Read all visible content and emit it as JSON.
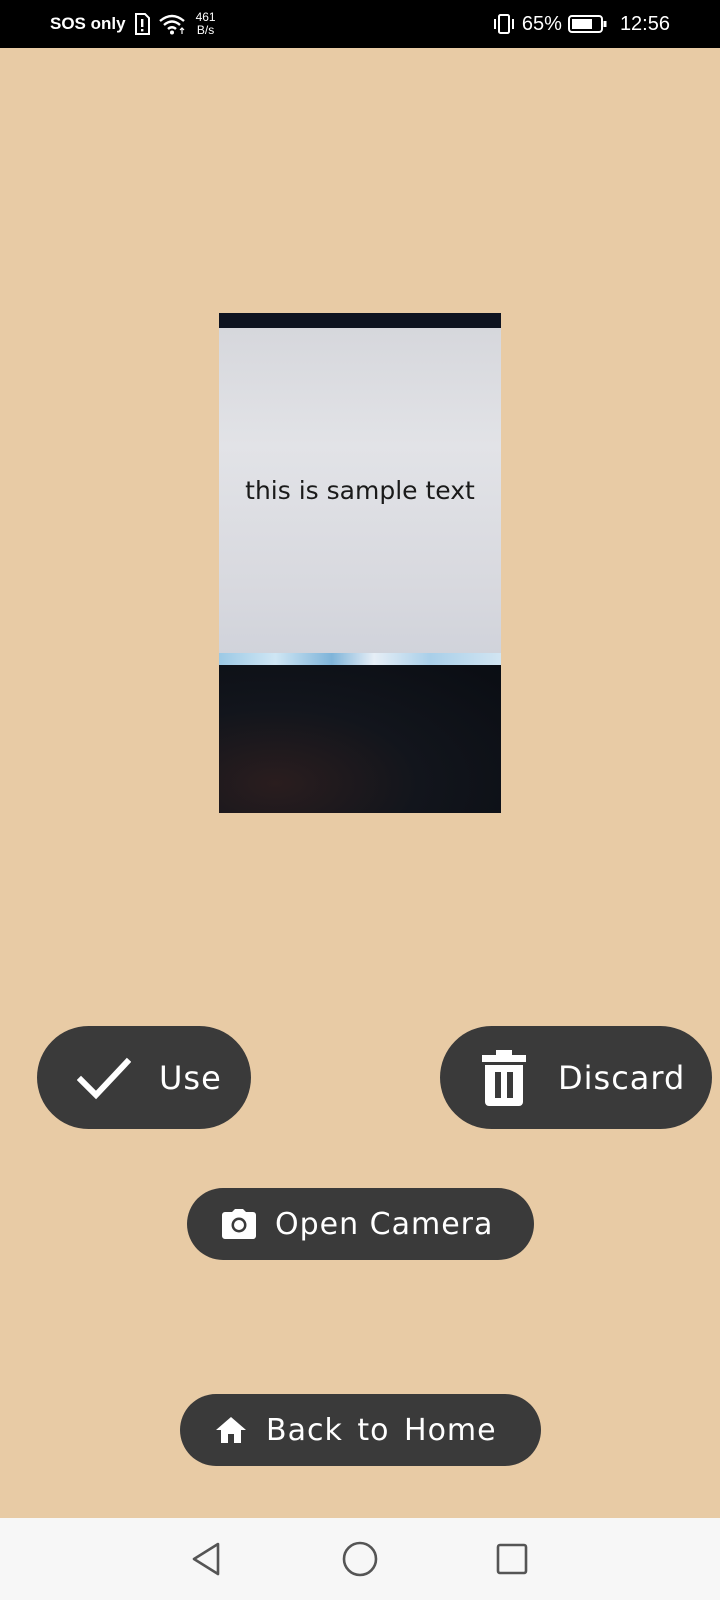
{
  "status_bar": {
    "carrier": "SOS only",
    "net_speed_value": "461",
    "net_speed_unit": "B/s",
    "battery_percent": "65%",
    "time": "12:56",
    "icons": [
      "sim-alert-icon",
      "wifi-icon",
      "vibrate-icon",
      "battery-icon"
    ]
  },
  "preview": {
    "photo_text": "this is sample text"
  },
  "actions": {
    "use_label": "Use",
    "discard_label": "Discard",
    "open_camera_label": "Open Camera",
    "back_home_label": "Back to Home"
  },
  "colors": {
    "background": "#e8cba5",
    "button": "#3a3a3a",
    "button_text": "#ffffff"
  },
  "nav_bar": {
    "icons": [
      "back-icon",
      "home-icon",
      "recents-icon"
    ]
  }
}
